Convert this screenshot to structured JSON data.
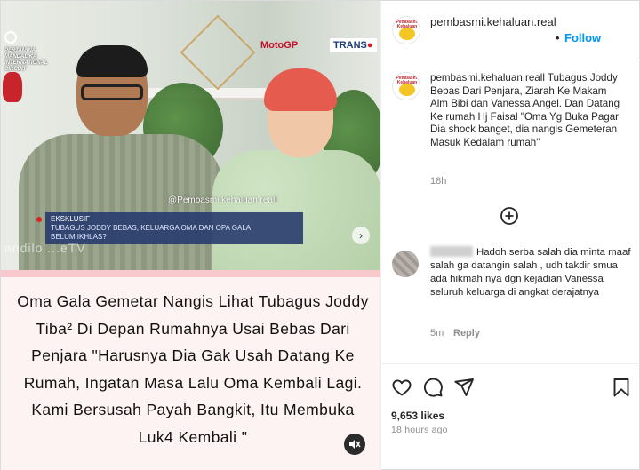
{
  "post": {
    "username": "pembasmi.kehaluan.real",
    "follow_label": "Follow",
    "dot": "•",
    "avatar_text": "Pembasmi Kehaluan"
  },
  "video": {
    "brand_left": "PERTAMINA MANDALIKA INTERNATIONAL CIRCUIT",
    "motogp_label": "MotoGP",
    "trans_label": "TRANS",
    "watermark": "@Pembasmi.kehaluan.reall",
    "lower_third_line1": "EKSKLUSIF",
    "lower_third_line2": "TUBAGUS JODDY BEBAS, KELUARGA OMA DAN OPA GALA",
    "lower_third_line3": "BELUM IKHLAS?",
    "channel_mark": "andilo ...eTV",
    "next_arrow": "›"
  },
  "caption_card": {
    "text": "Oma Gala Gemetar Nangis Lihat Tubagus Joddy Tiba² Di Depan Rumahnya Usai Bebas Dari Penjara \"Harusnya Dia Gak Usah Datang Ke Rumah, Ingatan Masa Lalu Oma Kembali Lagi. Kami Bersusah Payah Bangkit, Itu Membuka Luk4 Kembali \""
  },
  "caption": {
    "username": "pembasmi.kehaluan.reall",
    "text": "Tubagus Joddy Bebas Dari Penjara, Ziarah Ke Makam Alm Bibi dan Vanessa Angel. Dan Datang Ke rumah Hj Faisal \"Oma Yg Buka Pagar Dia shock banget, dia nangis Gemeteran Masuk Kedalam rumah\"",
    "time": "18h"
  },
  "comment": {
    "text": "Hadoh serba salah dia minta maaf salah ga datangin salah , udh takdir smua ada hikmah nya dgn kejadian Vanessa seluruh keluarga di angkat derajatnya",
    "time": "5m",
    "reply_label": "Reply"
  },
  "footer": {
    "likes": "9,653 likes",
    "ago": "18 hours ago"
  },
  "icons": {
    "like": "heart-icon",
    "comment": "comment-icon",
    "share": "send-icon",
    "save": "bookmark-icon",
    "more_comments": "plus-circle-icon",
    "mute": "speaker-muted-icon"
  },
  "colors": {
    "follow": "#0095f6",
    "muted_text": "#8e8e8e",
    "caption_card_bg": "#fdf3f2",
    "caption_card_border": "#f7c8cc"
  }
}
